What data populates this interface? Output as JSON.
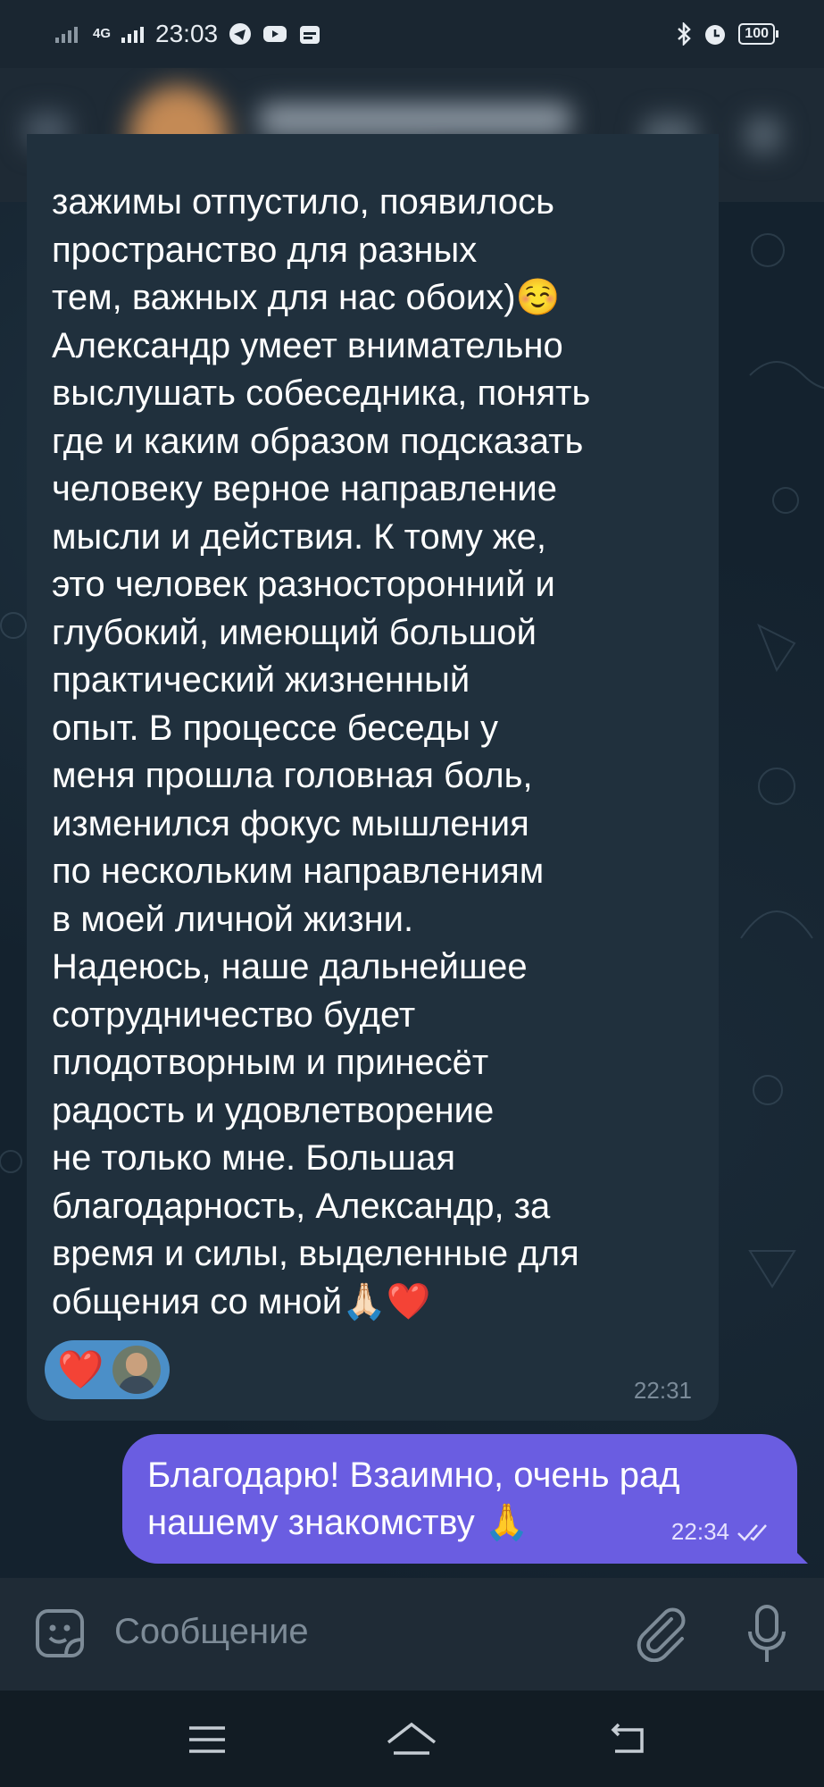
{
  "status_bar": {
    "network": "4G",
    "time": "23:03",
    "battery": "100"
  },
  "incoming_message": {
    "text": "зажимы отпустило, появилось\nпространство для разных\nтем, важных для нас обоих)☺️\nАлександр умеет внимательно\nвыслушать собеседника, понять\nгде и каким образом подсказать\nчеловеку верное направление\nмысли и действия. К тому же,\nэто человек разносторонний и\nглубокий, имеющий большой\nпрактический жизненный\nопыт. В процессе беседы у\nменя прошла головная боль,\nизменился фокус мышления\nпо нескольким направлениям\nв моей личной жизни.\nНадеюсь, наше дальнейшее\nсотрудничество будет\nплодотворным и принесёт\nрадость и удовлетворение\nне только мне. Большая\nблагодарность, Александр, за\nвремя и силы, выделенные для\nобщения со мной🙏🏻❤️",
    "reaction": "❤️",
    "time": "22:31"
  },
  "outgoing_message": {
    "text": "Благодарю! Взаимно, очень рад\nнашему знакомству 🙏",
    "time": "22:34",
    "status_icon": "double-check-icon"
  },
  "input": {
    "placeholder": "Сообщение"
  },
  "colors": {
    "incoming_bubble": "#20303d",
    "outgoing_bubble": "#6a5de1",
    "reaction_pill": "#4b8fc8"
  }
}
